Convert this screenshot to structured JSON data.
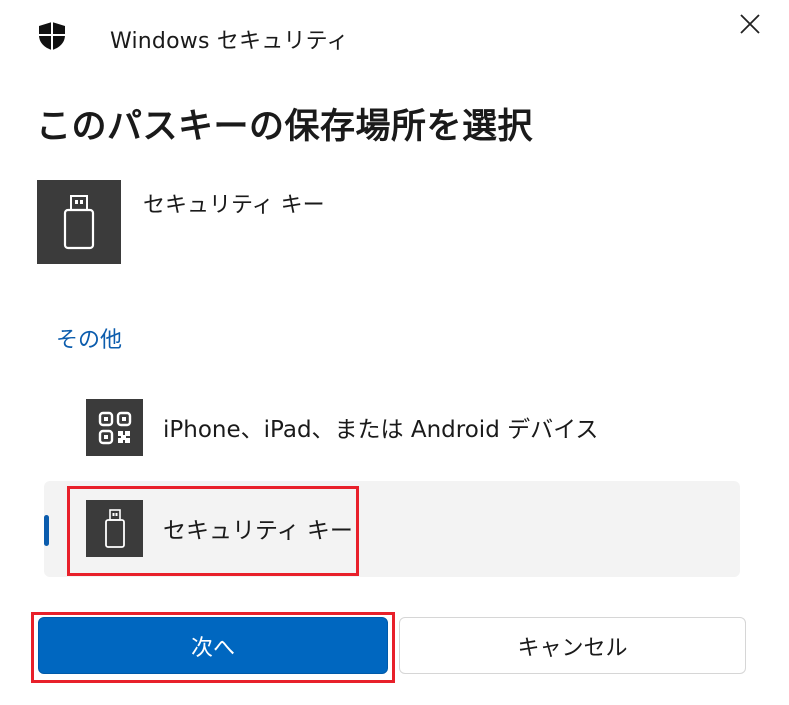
{
  "window": {
    "app_title": "Windows セキュリティ",
    "icons": {
      "app": "shield-icon",
      "close": "close-icon"
    }
  },
  "dialog": {
    "heading": "このパスキーの保存場所を選択",
    "primary_option": {
      "label": "セキュリティ キー",
      "icon": "usb-key-icon"
    },
    "other_section": {
      "header": "その他",
      "options": [
        {
          "label": "iPhone、iPad、または Android デバイス",
          "icon": "qr-code-icon",
          "selected": false
        },
        {
          "label": "セキュリティ キー",
          "icon": "usb-key-icon",
          "selected": true
        }
      ]
    }
  },
  "buttons": {
    "next": "次へ",
    "cancel": "キャンセル"
  },
  "colors": {
    "accent": "#0067c0",
    "link": "#0b5cad",
    "highlight_box": "#e8202a",
    "tile": "#3b3b3b",
    "selected_row": "#f3f3f3"
  }
}
